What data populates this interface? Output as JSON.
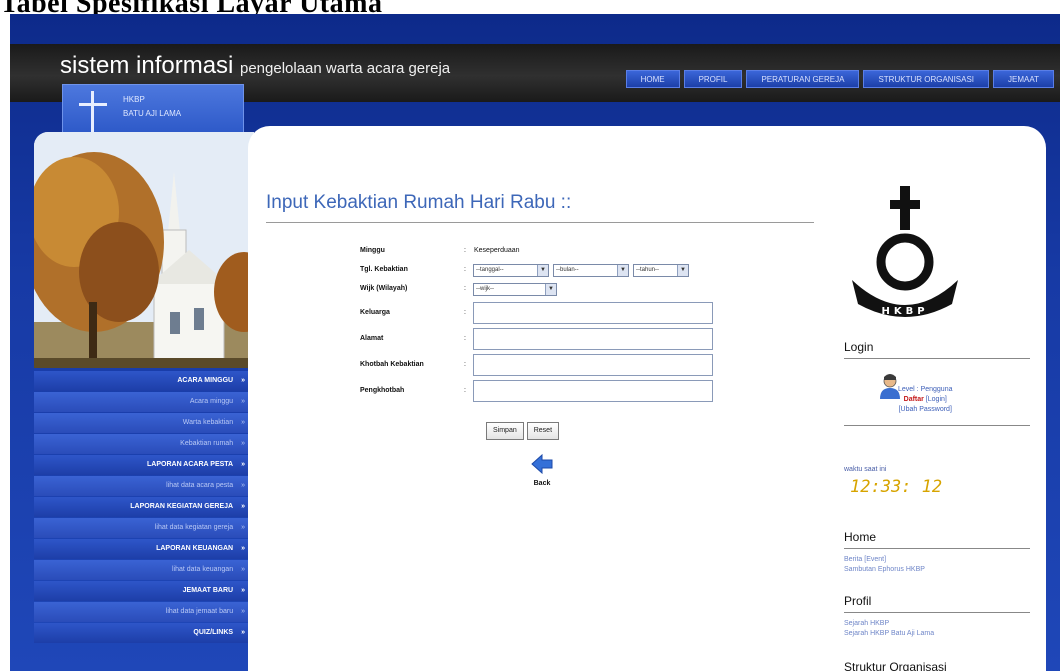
{
  "caption": "Tabel Spesifikasi Layar Utama",
  "header": {
    "app_title": "sistem informasi",
    "app_subtitle": "pengelolaan warta acara gereja",
    "nav": [
      "HOME",
      "PROFIL",
      "PERATURAN GEREJA",
      "STRUKTUR ORGANISASI",
      "JEMAAT"
    ]
  },
  "church": {
    "line1": "HKBP",
    "line2": "BATU AJI LAMA"
  },
  "sidebar_menu": [
    {
      "label": "ACARA MINGGU",
      "type": "head"
    },
    {
      "label": "Acara minggu",
      "type": "sub"
    },
    {
      "label": "Warta kebaktian",
      "type": "sub"
    },
    {
      "label": "Kebaktian rumah",
      "type": "sub"
    },
    {
      "label": "LAPORAN ACARA PESTA",
      "type": "head"
    },
    {
      "label": "lihat data acara pesta",
      "type": "sub"
    },
    {
      "label": "LAPORAN KEGIATAN GEREJA",
      "type": "head"
    },
    {
      "label": "lihat data kegiatan gereja",
      "type": "sub"
    },
    {
      "label": "LAPORAN KEUANGAN",
      "type": "head"
    },
    {
      "label": "lihat data keuangan",
      "type": "sub"
    },
    {
      "label": "JEMAAT BARU",
      "type": "head"
    },
    {
      "label": "lihat data jemaat baru",
      "type": "sub"
    },
    {
      "label": "QUIZ/LINKS",
      "type": "head"
    }
  ],
  "page": {
    "title": "Input Kebaktian Rumah Hari Rabu ::"
  },
  "form": {
    "minggu_label": "Minggu",
    "minggu_value": "Keseperduaan",
    "tgl_label": "Tgl. Kebaktian",
    "tgl_select": "--tanggal--",
    "bulan_select": "--bulan--",
    "tahun_select": "--tahun--",
    "wijk_label": "Wijk (Wilayah)",
    "wijk_select": "--wijk--",
    "keluarga_label": "Keluarga",
    "alamat_label": "Alamat",
    "khotbah_label": "Khotbah Kebaktian",
    "pengkhotbah_label": "Pengkhotbah",
    "simpan": "Simpan",
    "reset": "Reset",
    "back": "Back"
  },
  "right": {
    "login_title": "Login",
    "login_user": "Level : Pengguna",
    "login_daftar": "Daftar",
    "login_link1": "Login",
    "login_link2": "Ubah Password",
    "clock_caption": "waktu saat ini",
    "clock": "12:33: 12",
    "home_title": "Home",
    "home_link1": "Berita",
    "home_link2": "Event",
    "home_link3": "Sambutan Ephorus HKBP",
    "profil_title": "Profil",
    "profil_link1": "Sejarah HKBP",
    "profil_link2": "Sejarah HKBP Batu Aji Lama",
    "struktur_title": "Struktur Organisasi"
  },
  "colors": {
    "accent": "#2b52c6",
    "title": "#3d67b8",
    "clock": "#d7a400"
  }
}
